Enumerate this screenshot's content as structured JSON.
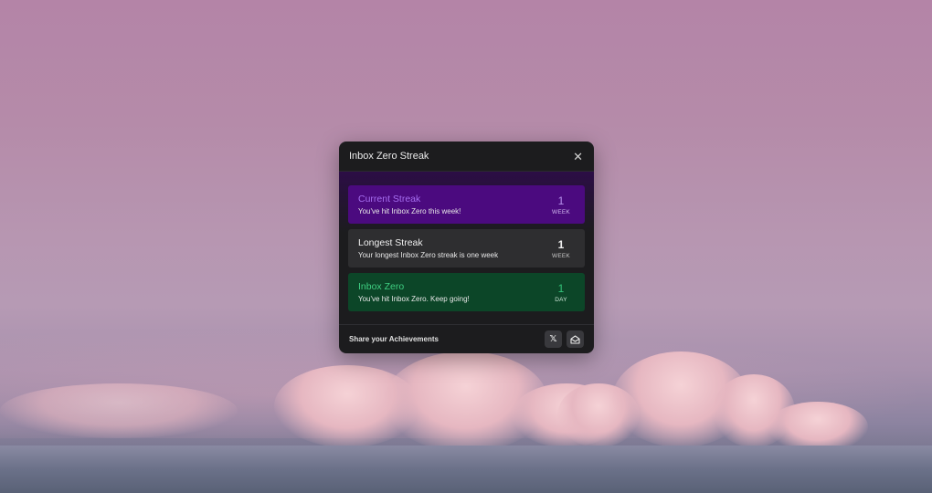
{
  "modal": {
    "title": "Inbox Zero Streak",
    "close_icon": "close-icon",
    "close_glyph": "✕"
  },
  "cards": [
    {
      "title": "Current Streak",
      "description": "You've hit Inbox Zero this week!",
      "value": "1",
      "unit": "WEEK",
      "accent": "#4b0a7f"
    },
    {
      "title": "Longest Streak",
      "description": "Your longest Inbox Zero streak is one week",
      "value": "1",
      "unit": "WEEK",
      "accent": "#2e2e30"
    },
    {
      "title": "Inbox Zero",
      "description": "You've hit Inbox Zero. Keep going!",
      "value": "1",
      "unit": "DAY",
      "accent": "#0c4628"
    }
  ],
  "footer": {
    "share_label": "Share your Achievements",
    "share_buttons": [
      {
        "icon": "x-logo-icon",
        "glyph": "𝕏"
      },
      {
        "icon": "mail-icon"
      }
    ]
  }
}
